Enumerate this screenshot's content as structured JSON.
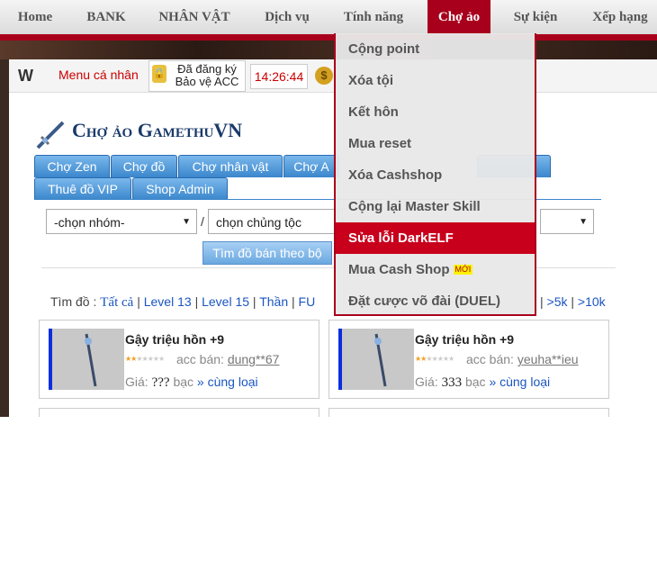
{
  "nav": {
    "items": [
      "Home",
      "BANK",
      "NHÂN VẬT",
      "Dịch vụ",
      "Tính năng",
      "Chợ ảo",
      "Sự kiện",
      "Xếp hạng"
    ],
    "active": "Chợ ảo"
  },
  "dropdown": {
    "items": [
      "Cộng point",
      "Xóa tội",
      "Kết hôn",
      "Mua reset",
      "Xóa Cashshop",
      "Cộng lại Master Skill",
      "Sửa lỗi DarkELF",
      "Mua Cash Shop",
      "Đặt cược võ đài (DUEL)"
    ],
    "highlighted": "Sửa lỗi DarkELF",
    "new_badge": "MỚI"
  },
  "topbar": {
    "menu_label": "Menu cá nhân",
    "lock_line1": "Đã đăng ký",
    "lock_line2": "Bảo vệ ACC",
    "time": "14:26:44"
  },
  "page": {
    "title": "Chợ ảo GamethuVN"
  },
  "tabs": {
    "row1": [
      "Chợ Zen",
      "Chợ đồ",
      "Chợ nhân vật",
      "Chợ A"
    ],
    "row2": [
      "Thuê đồ VIP",
      "Shop Admin"
    ]
  },
  "filters": {
    "group_select": "-chọn nhóm-",
    "race_select": "chọn chủng tộc",
    "btn_bo": "Tìm đồ bán theo bộ"
  },
  "levels": {
    "label": "Tìm đồ :",
    "items": [
      "Tất cả",
      "Level 13",
      "Level 15",
      "Thần",
      "FU"
    ],
    "tail": [
      ">5k",
      ">10k"
    ]
  },
  "cards": [
    {
      "name": "Gậy triệu hồn +9",
      "seller_label": "acc bán:",
      "seller": "dung**67",
      "price_label": "Giá:",
      "price": "???",
      "unit": "bạc",
      "more": "» cùng loại"
    },
    {
      "name": "Gậy triệu hồn +9",
      "seller_label": "acc bán:",
      "seller": "yeuha**ieu",
      "price_label": "Giá:",
      "price": "333",
      "unit": "bạc",
      "more": "» cùng loại"
    }
  ],
  "colors": {
    "brand_red": "#a8001c",
    "tab_blue": "#3a86cc",
    "link_blue": "#1a55c0"
  }
}
